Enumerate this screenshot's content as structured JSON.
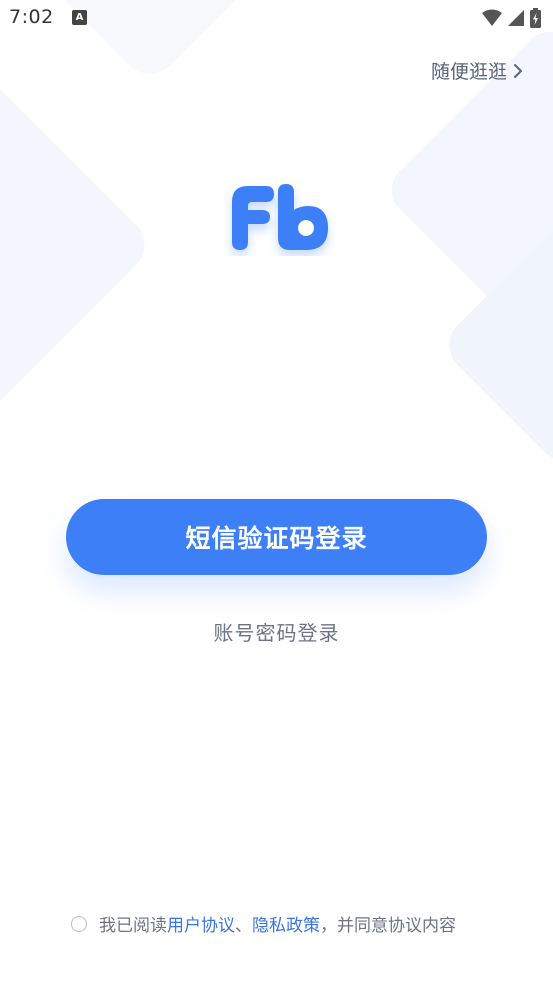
{
  "status_bar": {
    "time": "7:02",
    "notification_glyph": "A",
    "icons": [
      "wifi-icon",
      "signal-icon",
      "battery-charging-icon"
    ]
  },
  "header": {
    "browse_label": "随便逛逛",
    "browse_icon": "chevron-right-icon"
  },
  "logo": {
    "text": "Fb",
    "color": "#3d7ff7"
  },
  "actions": {
    "sms_login_label": "短信验证码登录",
    "password_login_label": "账号密码登录"
  },
  "agreement": {
    "prefix": "我已阅读",
    "user_agreement": "用户协议",
    "separator": "、",
    "privacy_policy": "隐私政策",
    "suffix": "，并同意协议内容",
    "checked": false
  },
  "colors": {
    "primary": "#3d7ff7",
    "link": "#3a74e6",
    "muted_text": "#6b7386"
  }
}
